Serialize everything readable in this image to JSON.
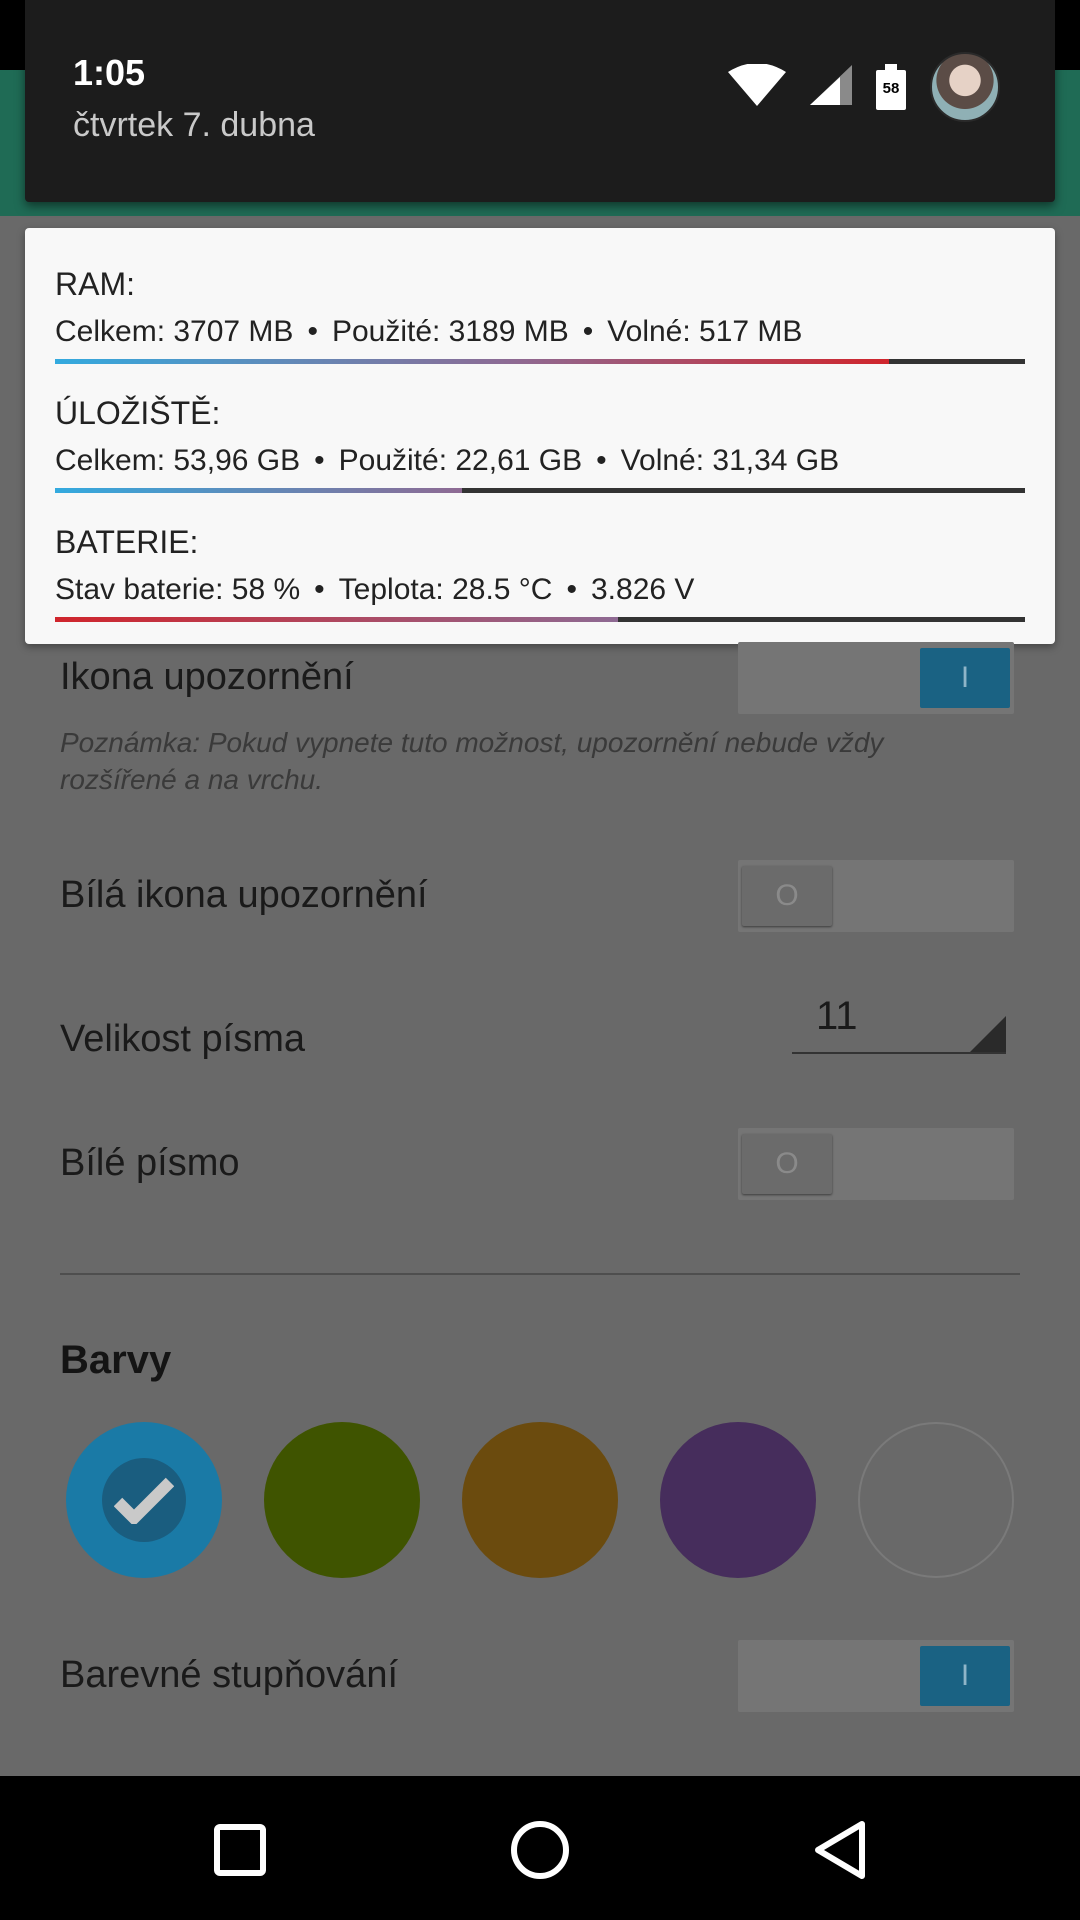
{
  "status": {
    "time": "1:05",
    "date": "čtvrtek 7. dubna",
    "battery_level": "58"
  },
  "card": {
    "ram": {
      "title": "RAM:",
      "items": [
        "Celkem: 3707 MB",
        "Použité: 3189 MB",
        "Volné: 517 MB"
      ],
      "fill": 0.86
    },
    "storage": {
      "title": "ÚLOŽIŠTĚ:",
      "items": [
        "Celkem: 53,96 GB",
        "Použité: 22,61 GB",
        "Volné: 31,34 GB"
      ],
      "fill": 0.42
    },
    "battery": {
      "title": "BATERIE:",
      "items": [
        "Stav baterie: 58 %",
        "Teplota: 28.5 °C",
        "3.826 V"
      ],
      "fill": 0.58
    },
    "separator": "•"
  },
  "settings": {
    "notif_icon": {
      "label": "Ikona upozornění",
      "state": "I"
    },
    "note": "Poznámka: Pokud vypnete tuto možnost, upozornění nebude vždy rozšířené a na vrchu.",
    "white_icon": {
      "label": "Bílá ikona upozornění",
      "state": "O"
    },
    "font_size": {
      "label": "Velikost písma",
      "value": "11"
    },
    "white_font": {
      "label": "Bílé písmo",
      "state": "O"
    },
    "colors_title": "Barvy",
    "swatches": [
      "#1a7aa6",
      "#3f5400",
      "#6b4b0e",
      "#462d5c",
      "transparent"
    ],
    "gradient": {
      "label": "Barevné stupňování",
      "state": "I"
    }
  },
  "colors": {
    "accent": "#1a6283",
    "appbar": "#1f6b55"
  }
}
